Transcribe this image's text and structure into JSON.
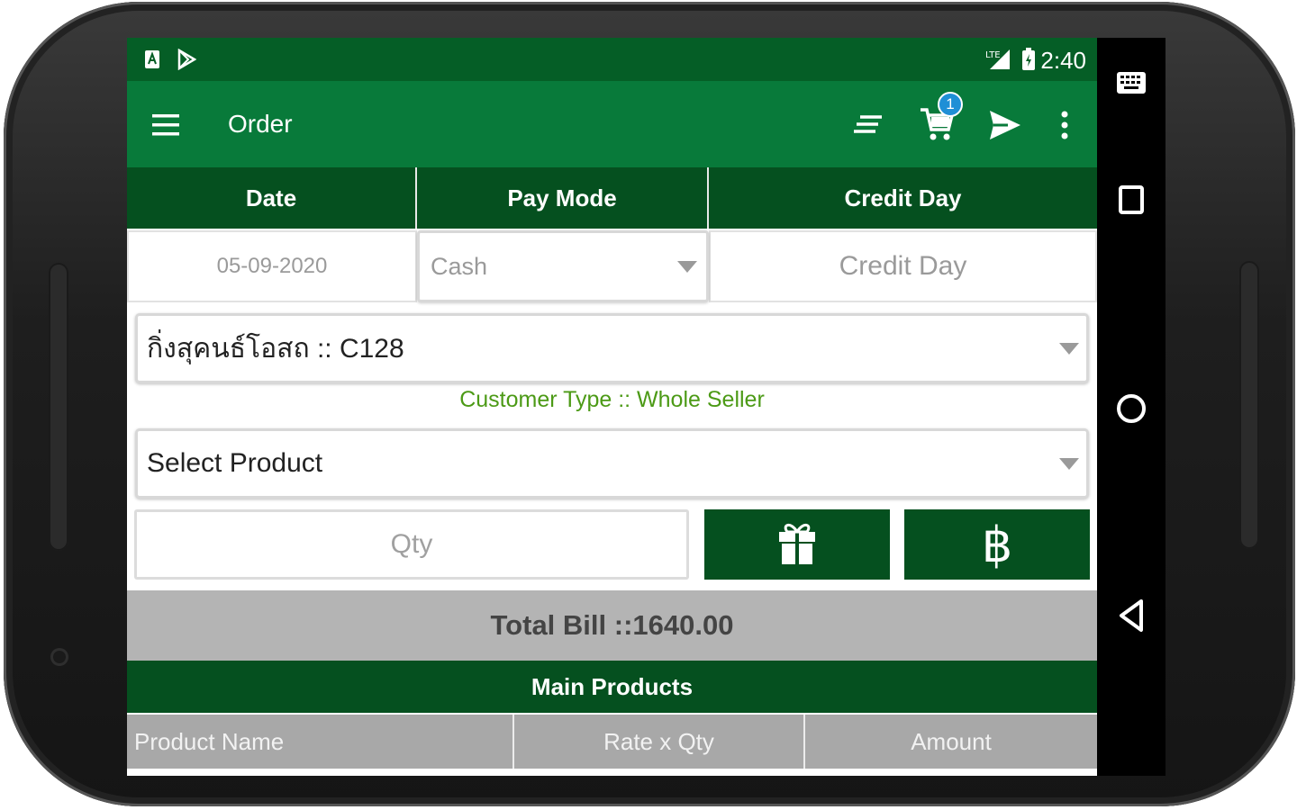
{
  "status_bar": {
    "time": "2:40",
    "icons": [
      "notification-a-icon",
      "play-store-icon",
      "signal-lte-icon",
      "battery-icon"
    ]
  },
  "toolbar": {
    "title": "Order",
    "menu_icon": "hamburger-menu-icon",
    "actions": [
      "list-icon",
      "cart-icon",
      "send-icon",
      "more-vert-icon"
    ],
    "cart_badge": "1"
  },
  "header": {
    "columns": [
      "Date",
      "Pay Mode",
      "Credit Day"
    ]
  },
  "inputs": {
    "date_value": "05-09-2020",
    "pay_mode_value": "Cash",
    "credit_day_placeholder": "Credit Day"
  },
  "customer": {
    "selected": "กิ่งสุคนธ์โอสถ :: C128",
    "type_text": "Customer Type :: Whole Seller"
  },
  "product": {
    "placeholder": "Select Product",
    "qty_placeholder": "Qty",
    "gift_icon": "gift-icon",
    "currency_symbol": "฿"
  },
  "total": {
    "text": "Total Bill ::1640.00"
  },
  "section_title": "Main Products",
  "table": {
    "columns": [
      "Product Name",
      "Rate x Qty",
      "Amount"
    ]
  },
  "nav_bar": {
    "icons": [
      "keyboard-icon",
      "recents-square-icon",
      "home-circle-icon",
      "back-triangle-icon"
    ]
  },
  "colors": {
    "status_bar": "#055e26",
    "toolbar": "#087a3a",
    "dark_green": "#05501f",
    "customer_type": "#4c9a16",
    "total_bg": "#b4b4b4",
    "table_header_bg": "#a8a8a8",
    "badge": "#1f8fd6"
  }
}
